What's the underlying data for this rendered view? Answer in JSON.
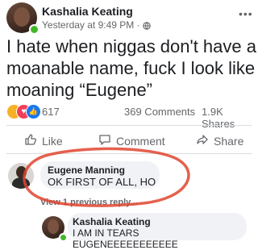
{
  "post": {
    "author": "Kashalia Keating",
    "timestamp": "Yesterday at 9:49 PM ·",
    "privacy_icon": "globe-icon",
    "menu_icon": "more-dots-icon",
    "text_line1": "I hate when niggas don't have a",
    "text_line2": "moanable name, fuck I look like",
    "text_line3": "moaning “Eugene”"
  },
  "stats": {
    "reaction_count": "617",
    "comments": "369 Comments",
    "shares": "1.9K Shares"
  },
  "actions": {
    "like": "Like",
    "comment": "Comment",
    "share": "Share"
  },
  "comments": [
    {
      "author": "Eugene Manning",
      "text": "OK FIRST OF ALL, HO"
    }
  ],
  "replies_link": "View 1 previous reply...",
  "reply": {
    "author": "Kashalia Keating",
    "text": "I AM IN TEARS EUGENEEEEEEEEEEE"
  },
  "colors": {
    "annotation_circle": "#e0452f",
    "online": "#42b72a",
    "like_blue": "#1877f2",
    "love_red": "#f33e58"
  }
}
